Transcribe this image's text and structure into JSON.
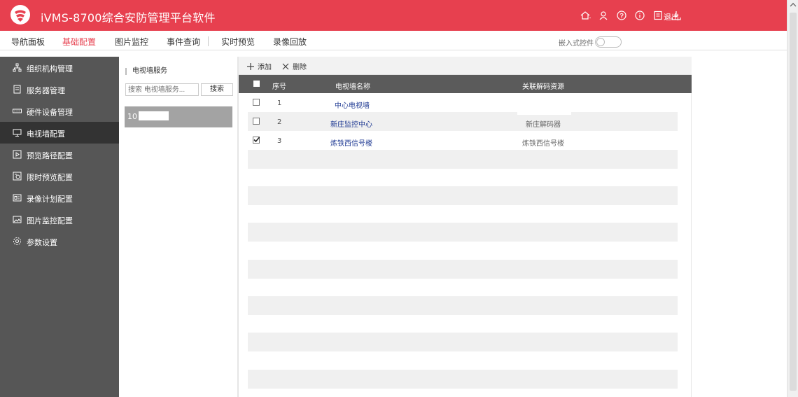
{
  "app": {
    "title": "iVMS-8700综合安防管理平台软件",
    "logout_label": "退出",
    "icons": [
      "home-icon",
      "user-icon",
      "help-icon",
      "info-icon",
      "clipboard-icon",
      "download-icon"
    ]
  },
  "nav": {
    "items": [
      {
        "label": "导航面板"
      },
      {
        "label": "基础配置"
      },
      {
        "label": "图片监控"
      },
      {
        "label": "事件查询"
      },
      {
        "label": "实时预览"
      },
      {
        "label": "录像回放"
      }
    ],
    "active_index": 1,
    "embed_label": "嵌入式控件",
    "embed_toggle_on": false
  },
  "sidebar": {
    "items": [
      {
        "label": "组织机构管理",
        "icon": "org-icon"
      },
      {
        "label": "服务器管理",
        "icon": "server-icon"
      },
      {
        "label": "硬件设备管理",
        "icon": "device-icon"
      },
      {
        "label": "电视墙配置",
        "icon": "monitor-icon"
      },
      {
        "label": "预览路径配置",
        "icon": "play-icon"
      },
      {
        "label": "限时预览配置",
        "icon": "timer-icon"
      },
      {
        "label": "录像计划配置",
        "icon": "record-plan-icon"
      },
      {
        "label": "图片监控配置",
        "icon": "picture-icon"
      },
      {
        "label": "参数设置",
        "icon": "gear-icon"
      }
    ],
    "active_index": 3
  },
  "middle": {
    "title": "电视墙服务",
    "search_placeholder": "搜索 电视墙服务...",
    "search_button": "搜索",
    "server_item_label": "10"
  },
  "toolbar": {
    "add_label": "添加",
    "delete_label": "删除"
  },
  "table": {
    "columns": [
      "序号",
      "电视墙名称",
      "关联解码资源"
    ],
    "rows": [
      {
        "index": "1",
        "name": "中心电视墙",
        "resource": "",
        "checked": false
      },
      {
        "index": "2",
        "name": "新庄监控中心",
        "resource": "新庄解码器",
        "checked": false
      },
      {
        "index": "3",
        "name": "炼铁西信号楼",
        "resource": "炼铁西信号楼",
        "checked": true
      }
    ]
  },
  "colors": {
    "brand_red": "#e7404f",
    "sidebar_bg": "#565656",
    "sidebar_active": "#333333",
    "table_header": "#5b5b5b",
    "link_blue": "#1f3a93"
  }
}
